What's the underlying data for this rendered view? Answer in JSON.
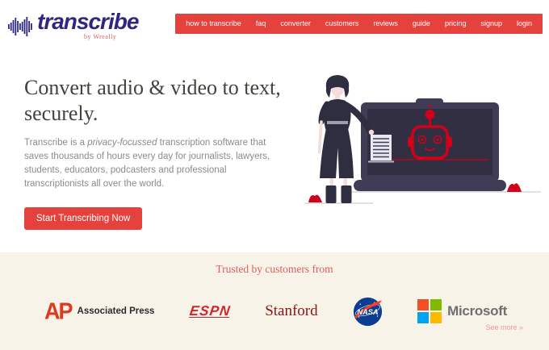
{
  "colors": {
    "accent_red": "#e5423d",
    "logo_indigo": "#2e2781",
    "heading_text": "#45413b",
    "body_text": "#8d8b88",
    "trusted_background": "#f7f3e9",
    "trusted_title_red": "#dd5f5f",
    "stanford_red": "#8c1515",
    "ap_red": "#dd3b20",
    "espn_red": "#d6222b",
    "nasa_blue": "#0b3d91",
    "illustration_dark": "#2f2e41",
    "laptop_slate": "#3f3d56",
    "robot_red": "#d0021b",
    "microsoft_squares": [
      "#f25022",
      "#7fba00",
      "#00a4ef",
      "#ffb900"
    ]
  },
  "header": {
    "logo_text": "transcribe",
    "logo_byline": "by Wreally",
    "nav": [
      "how to transcribe",
      "faq",
      "converter",
      "customers",
      "reviews",
      "guide",
      "pricing",
      "signup",
      "login"
    ]
  },
  "hero": {
    "heading": "Convert audio & video to text, securely.",
    "body_pre": "Transcribe is a ",
    "body_emphasis": "privacy-focussed",
    "body_post": " transcription software that saves thousands of hours every day for journalists, lawyers, students, educators, podcasters and professional transcriptionists all over the world.",
    "cta_label": "Start Transcribing Now",
    "illustration_alt": "woman presenting a laptop showing a red robot face"
  },
  "trusted": {
    "heading": "Trusted by customers from",
    "logos": [
      {
        "id": "ap",
        "mark": "AP",
        "label": "Associated Press"
      },
      {
        "id": "espn",
        "label": "ESPN"
      },
      {
        "id": "stanford",
        "label": "Stanford"
      },
      {
        "id": "nasa",
        "label": "NASA"
      },
      {
        "id": "microsoft",
        "label": "Microsoft"
      }
    ],
    "see_more": "See more »"
  }
}
